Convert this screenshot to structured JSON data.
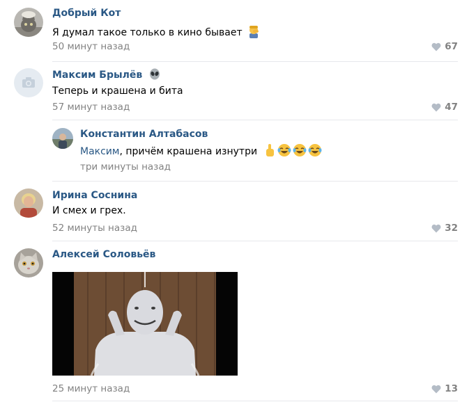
{
  "comments": [
    {
      "author": "Добрый Кот",
      "text": "Я думал такое только в кино бывает",
      "emoji": "facepalm-emoji",
      "time": "50 минут назад",
      "likes": "67"
    },
    {
      "author": "Максим Брылёв",
      "author_badge": "alien-emoji",
      "text": "Теперь и крашена и бита",
      "time": "57 минут назад",
      "likes": "47",
      "replies": [
        {
          "author": "Константин Алтабасов",
          "mention": "Максим",
          "text": ", причём крашена изнутри",
          "emojis": [
            "point-up-emoji",
            "tears-of-joy-emoji",
            "tears-of-joy-emoji",
            "tears-of-joy-emoji"
          ],
          "time": "три минуты назад"
        }
      ]
    },
    {
      "author": "Ирина Соснина",
      "text": "И смех и грех.",
      "time": "52 минуты назад",
      "likes": "32"
    },
    {
      "author": "Алексей Соловьёв",
      "attachment": "photo-man-covered-in-white-paint",
      "time": "25 минут назад",
      "likes": "13"
    }
  ],
  "colors": {
    "author": "#2a5885",
    "meta": "#828282",
    "separator": "#e7e8ec"
  }
}
